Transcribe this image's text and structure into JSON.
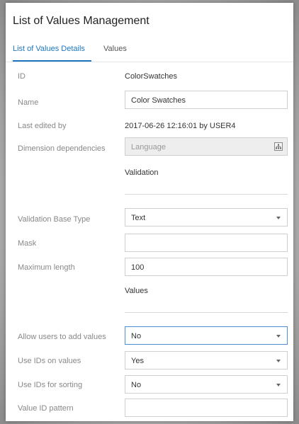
{
  "window": {
    "title": "List of Values Management"
  },
  "tabs": [
    {
      "label": "List of Values Details",
      "active": true
    },
    {
      "label": "Values",
      "active": false
    }
  ],
  "details": {
    "id": {
      "label": "ID",
      "value": "ColorSwatches"
    },
    "name": {
      "label": "Name",
      "value": "Color Swatches"
    },
    "last_edited": {
      "label": "Last edited by",
      "value": "2017-06-26 12:16:01 by USER4"
    },
    "dimension": {
      "label": "Dimension dependencies",
      "placeholder": "Language",
      "icon": "hierarchy-icon"
    }
  },
  "validation": {
    "heading": "Validation",
    "base_type": {
      "label": "Validation Base Type",
      "value": "Text"
    },
    "mask": {
      "label": "Mask",
      "value": ""
    },
    "max_length": {
      "label": "Maximum length",
      "value": "100"
    }
  },
  "values_section": {
    "heading": "Values",
    "allow_add": {
      "label": "Allow users to add values",
      "value": "No"
    },
    "use_ids": {
      "label": "Use IDs on values",
      "value": "Yes"
    },
    "use_ids_sorting": {
      "label": "Use IDs for sorting",
      "value": "No"
    },
    "id_pattern": {
      "label": "Value ID pattern",
      "value": ""
    }
  },
  "colors": {
    "accent": "#1d77c4",
    "focus_border": "#4d8fd6"
  }
}
